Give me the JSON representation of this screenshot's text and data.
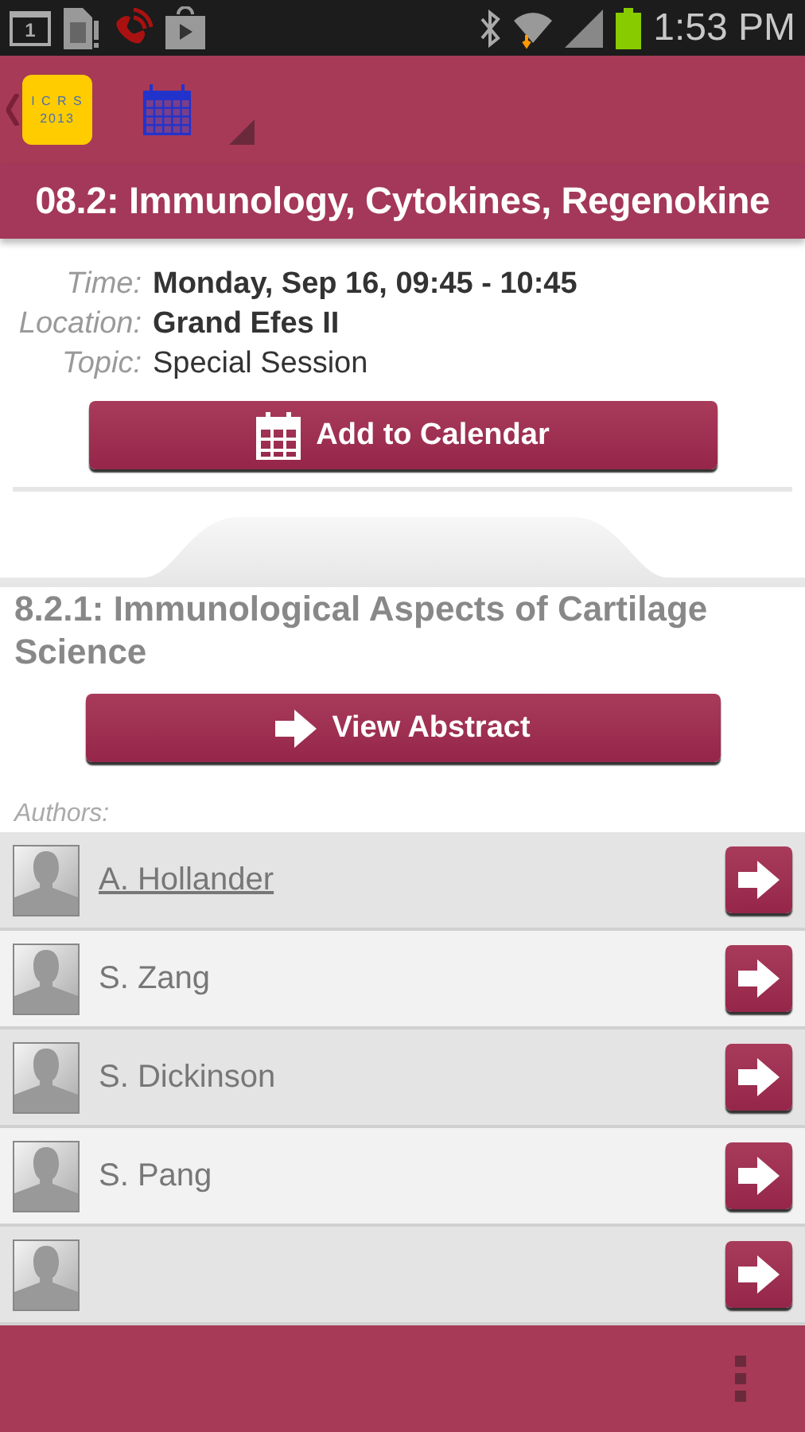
{
  "status_bar": {
    "time": "1:53 PM",
    "notification_badge": "1"
  },
  "app_bar": {
    "logo": {
      "line1": "I C R S",
      "line2": "2013"
    }
  },
  "session": {
    "title": "08.2: Immunology, Cytokines, Regenokine",
    "details": [
      {
        "label": "Time:",
        "value": "Monday, Sep 16, 09:45 - 10:45",
        "bold": true
      },
      {
        "label": "Location:",
        "value": "Grand Efes II",
        "bold": true
      },
      {
        "label": "Topic:",
        "value": "Special Session",
        "bold": false
      }
    ],
    "calendar_button": "Add to Calendar"
  },
  "talk": {
    "title": "8.2.1: Immunological Aspects of Cartilage Science",
    "abstract_button": "View Abstract",
    "authors_label": "Authors:",
    "authors": [
      {
        "kind": "author",
        "name": "A. Hollander",
        "selected": true
      },
      {
        "kind": "author",
        "name": "S. Zang",
        "selected": false
      },
      {
        "kind": "author",
        "name": "S. Dickinson",
        "selected": false
      },
      {
        "kind": "author",
        "name": "S. Pang",
        "selected": false
      },
      {
        "kind": "partial"
      }
    ]
  }
}
